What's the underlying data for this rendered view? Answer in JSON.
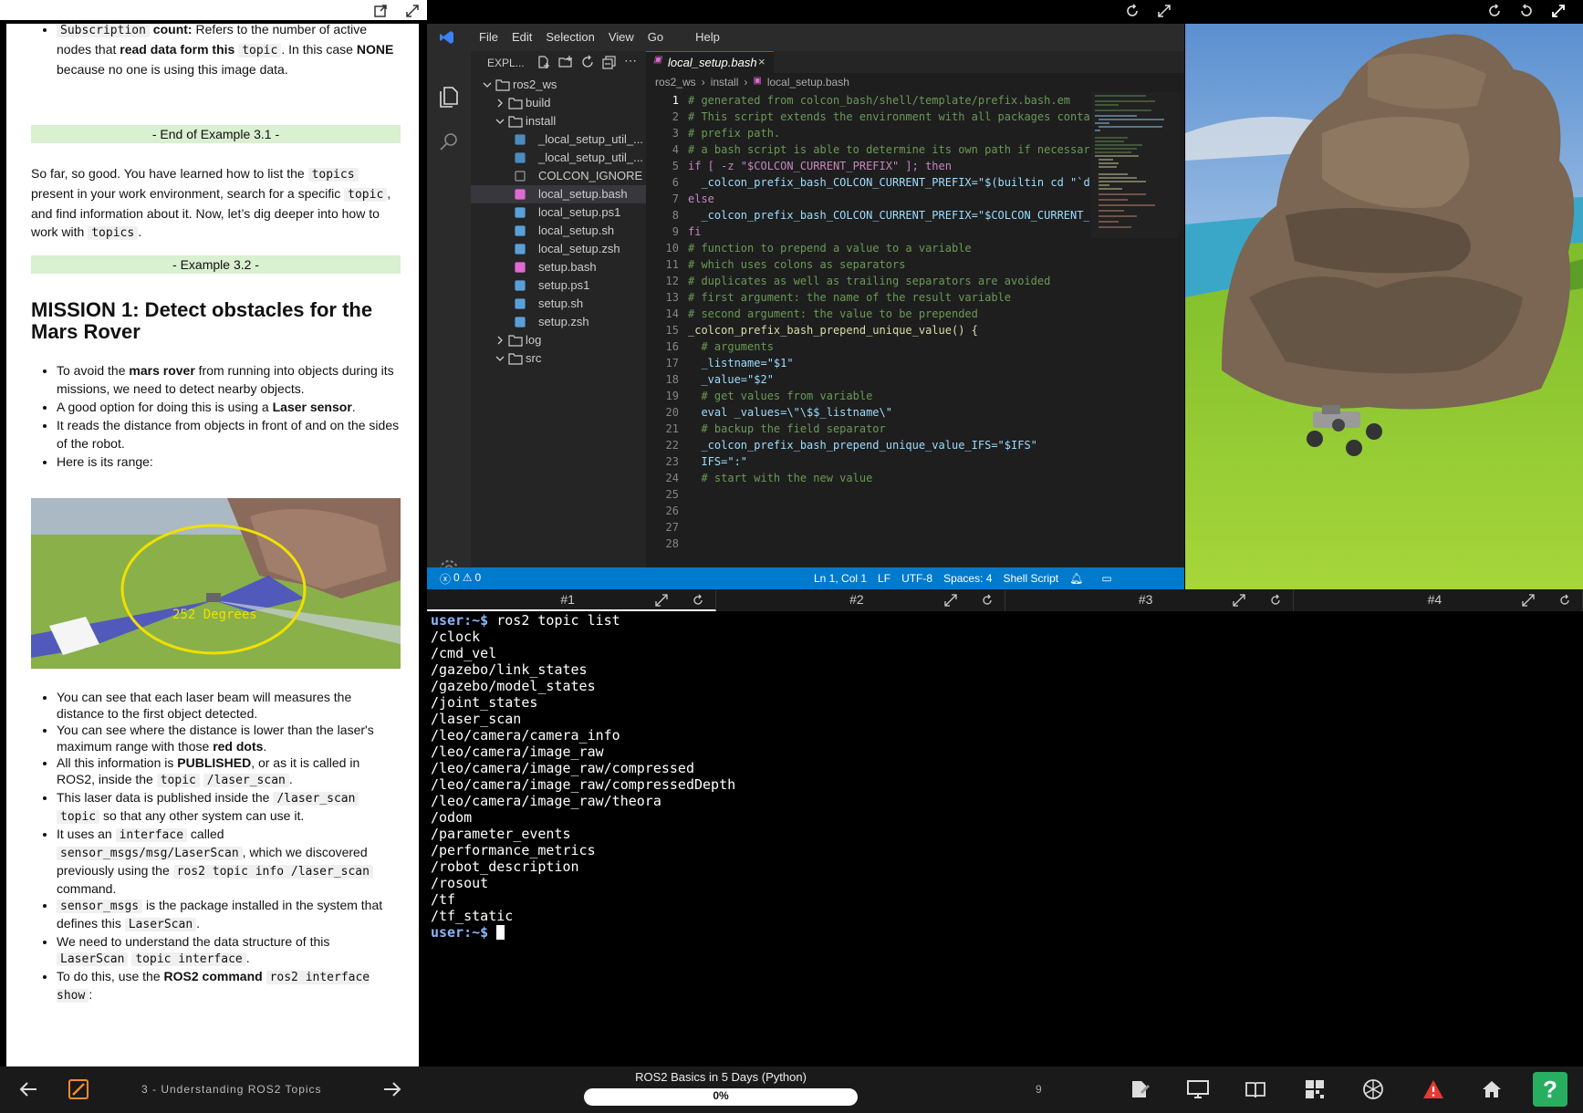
{
  "notebook": {
    "subscription_prefix": "Subscription",
    "subscription_label": " count:",
    "subscription_text1": " Refers to the number of active nodes that ",
    "subscription_bold": "read data form this",
    "subscription_code": "topic",
    "subscription_text2": ". In this case ",
    "subscription_none": "NONE",
    "subscription_text3": " because no one is using this image data.",
    "end_example": "- End of Example 3.1 -",
    "para_a": "So far, so good. You have learned how to list the ",
    "para_code1": "topics",
    "para_b": " present in your work environment, search for a specific ",
    "para_code2": "topic",
    "para_c": ", and find information about it. Now, let’s dig deeper into how to work with ",
    "para_code3": "topics",
    "para_d": ".",
    "example_32": "- Example 3.2 -",
    "mission_title": "MISSION 1: Detect obstacles for the Mars Rover",
    "b1a": "To avoid the ",
    "b1b": "mars rover",
    "b1c": " from running into objects during its missions, we need to detect nearby objects.",
    "b2a": "A good option for doing this is using a ",
    "b2b": "Laser sensor",
    "b2c": ".",
    "b3": "It reads the distance from objects in front of and on the sides of the robot.",
    "b4": "Here is its range:",
    "range_label": "252 Degrees",
    "c1": "You can see that each laser beam will measures the distance to the first object detected.",
    "c2a": "You can see where the distance is lower than the laser's maximum range with those ",
    "c2b": "red dots",
    "c2c": ".",
    "c3a": "All this information is ",
    "c3b": "PUBLISHED",
    "c3c": ", or as it is called in ROS2, inside the ",
    "c3d": "topic",
    "c3e": "/laser_scan",
    "c3f": ".",
    "c4a": "This laser data is published inside the ",
    "c4b": "/laser_scan",
    "c4c": "topic",
    "c4d": " so that any other system can use it.",
    "c5a": "It uses an ",
    "c5b": "interface",
    "c5c": " called ",
    "c5d": "sensor_msgs/msg/LaserScan",
    "c5e": ", which we discovered previously using the ",
    "c5f": "ros2 topic info /laser_scan",
    "c5g": " command.",
    "c6a": "sensor_msgs",
    "c6b": " is the package installed in the system that defines this ",
    "c6c": "LaserScan",
    "c6d": ".",
    "c7a": "We need to understand the data structure of this ",
    "c7b": "LaserScan",
    "c7c": "topic interface",
    "c7d": ".",
    "c8a": "To do this, use the ",
    "c8b": "ROS2 command",
    "c8c": "ros2 interface show",
    "c8d": ":"
  },
  "vscode": {
    "menu": [
      "File",
      "Edit",
      "Selection",
      "View",
      "Go",
      "Help"
    ],
    "explorer_label": "EXPL...",
    "tab_label": "local_setup.bash",
    "breadcrumb": [
      "ros2_ws",
      "install",
      "local_setup.bash"
    ],
    "tree": [
      {
        "label": "ros2_ws",
        "depth": 0,
        "kind": "folder-open"
      },
      {
        "label": "build",
        "depth": 1,
        "kind": "folder-closed"
      },
      {
        "label": "install",
        "depth": 1,
        "kind": "folder-open"
      },
      {
        "label": "_local_setup_util_...",
        "depth": 2,
        "kind": "py"
      },
      {
        "label": "_local_setup_util_...",
        "depth": 2,
        "kind": "py"
      },
      {
        "label": "COLCON_IGNORE",
        "depth": 2,
        "kind": "file"
      },
      {
        "label": "local_setup.bash",
        "depth": 2,
        "kind": "bash"
      },
      {
        "label": "local_setup.ps1",
        "depth": 2,
        "kind": "ps"
      },
      {
        "label": "local_setup.sh",
        "depth": 2,
        "kind": "ps"
      },
      {
        "label": "local_setup.zsh",
        "depth": 2,
        "kind": "ps"
      },
      {
        "label": "setup.bash",
        "depth": 2,
        "kind": "bash"
      },
      {
        "label": "setup.ps1",
        "depth": 2,
        "kind": "ps"
      },
      {
        "label": "setup.sh",
        "depth": 2,
        "kind": "ps"
      },
      {
        "label": "setup.zsh",
        "depth": 2,
        "kind": "ps"
      },
      {
        "label": "log",
        "depth": 1,
        "kind": "folder-closed"
      },
      {
        "label": "src",
        "depth": 1,
        "kind": "folder-open"
      }
    ],
    "code_lines": [
      "# generated from colcon_bash/shell/template/prefix.bash.em",
      "",
      "# This script extends the environment with all packages conta",
      "# prefix path.",
      "",
      "# a bash script is able to determine its own path if necessar",
      "if [ -z \"$COLCON_CURRENT_PREFIX\" ]; then",
      "  _colcon_prefix_bash_COLCON_CURRENT_PREFIX=\"$(builtin cd \"`d",
      "else",
      "  _colcon_prefix_bash_COLCON_CURRENT_PREFIX=\"$COLCON_CURRENT_",
      "fi",
      "",
      "# function to prepend a value to a variable",
      "# which uses colons as separators",
      "# duplicates as well as trailing separators are avoided",
      "# first argument: the name of the result variable",
      "# second argument: the value to be prepended",
      "_colcon_prefix_bash_prepend_unique_value() {",
      "  # arguments",
      "  _listname=\"$1\"",
      "  _value=\"$2\"",
      "",
      "  # get values from variable",
      "  eval _values=\\\"\\$$_listname\\\"",
      "  # backup the field separator",
      "  _colcon_prefix_bash_prepend_unique_value_IFS=\"$IFS\"",
      "  IFS=\":\"",
      "  # start with the new value"
    ],
    "status": {
      "problems": "0",
      "warnings": "0",
      "position": "Ln 1, Col 1",
      "eol": "LF",
      "encoding": "UTF-8",
      "spaces": "Spaces: 4",
      "language": "Shell Script"
    }
  },
  "terminal_tabs": [
    "#1",
    "#2",
    "#3",
    "#4"
  ],
  "terminal": {
    "prompt": "user:~$",
    "command": " ros2 topic list",
    "output": [
      "/clock",
      "/cmd_vel",
      "/gazebo/link_states",
      "/gazebo/model_states",
      "/joint_states",
      "/laser_scan",
      "/leo/camera/camera_info",
      "/leo/camera/image_raw",
      "/leo/camera/image_raw/compressed",
      "/leo/camera/image_raw/compressedDepth",
      "/leo/camera/image_raw/theora",
      "/odom",
      "/parameter_events",
      "/performance_metrics",
      "/robot_description",
      "/rosout",
      "/tf",
      "/tf_static"
    ]
  },
  "bottom": {
    "unit": "3 - Understanding ROS2 Topics",
    "course": "ROS2 Basics in 5 Days (Python)",
    "progress_label": "0%",
    "progress": 0,
    "count": "9",
    "help": "?"
  },
  "colors": {
    "accent": "#007acc",
    "prompt": "#8ab4f8",
    "green": "#27ae60",
    "alert": "#e53935"
  }
}
